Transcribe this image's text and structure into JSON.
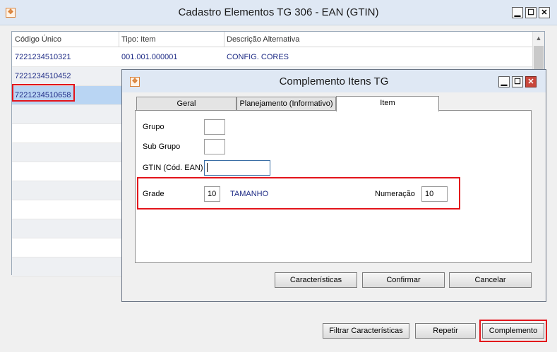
{
  "window": {
    "title": "Cadastro Elementos TG 306 - EAN (GTIN)",
    "icon": "app-logo-icon",
    "controls": {
      "minimize": "▁",
      "maximize": "☐",
      "close": "✕"
    }
  },
  "grid": {
    "columns": [
      "Código Único",
      "Tipo: Item",
      "Descrição Alternativa"
    ],
    "rows": [
      {
        "codigo": "7221234510321",
        "tipo": "001.001.000001",
        "descricao": "CONFIG. CORES"
      },
      {
        "codigo": "7221234510452",
        "tipo": "",
        "descricao": ""
      },
      {
        "codigo": "7221234510658",
        "tipo": "",
        "descricao": ""
      }
    ]
  },
  "footer_buttons": {
    "filtrar": "Filtrar Características",
    "repetir": "Repetir",
    "complemento": "Complemento"
  },
  "dialog": {
    "title": "Complemento Itens TG",
    "tabs": [
      "Geral",
      "Planejamento (Informativo)",
      "Item"
    ],
    "active_tab": "Item",
    "labels": {
      "grupo": "Grupo",
      "sub_grupo": "Sub Grupo",
      "gtin": "GTIN (Cód. EAN)",
      "grade": "Grade",
      "numeracao": "Numeração"
    },
    "values": {
      "grupo": "",
      "sub_grupo": "",
      "gtin": "",
      "grade": "10",
      "grade_desc": "TAMANHO",
      "numeracao": "10"
    },
    "buttons": {
      "caracteristicas": "Características",
      "confirmar": "Confirmar",
      "cancelar": "Cancelar"
    }
  },
  "colors": {
    "highlight": "#e3141b",
    "selection": "#b9d5f3",
    "link_text": "#1f2c86"
  }
}
